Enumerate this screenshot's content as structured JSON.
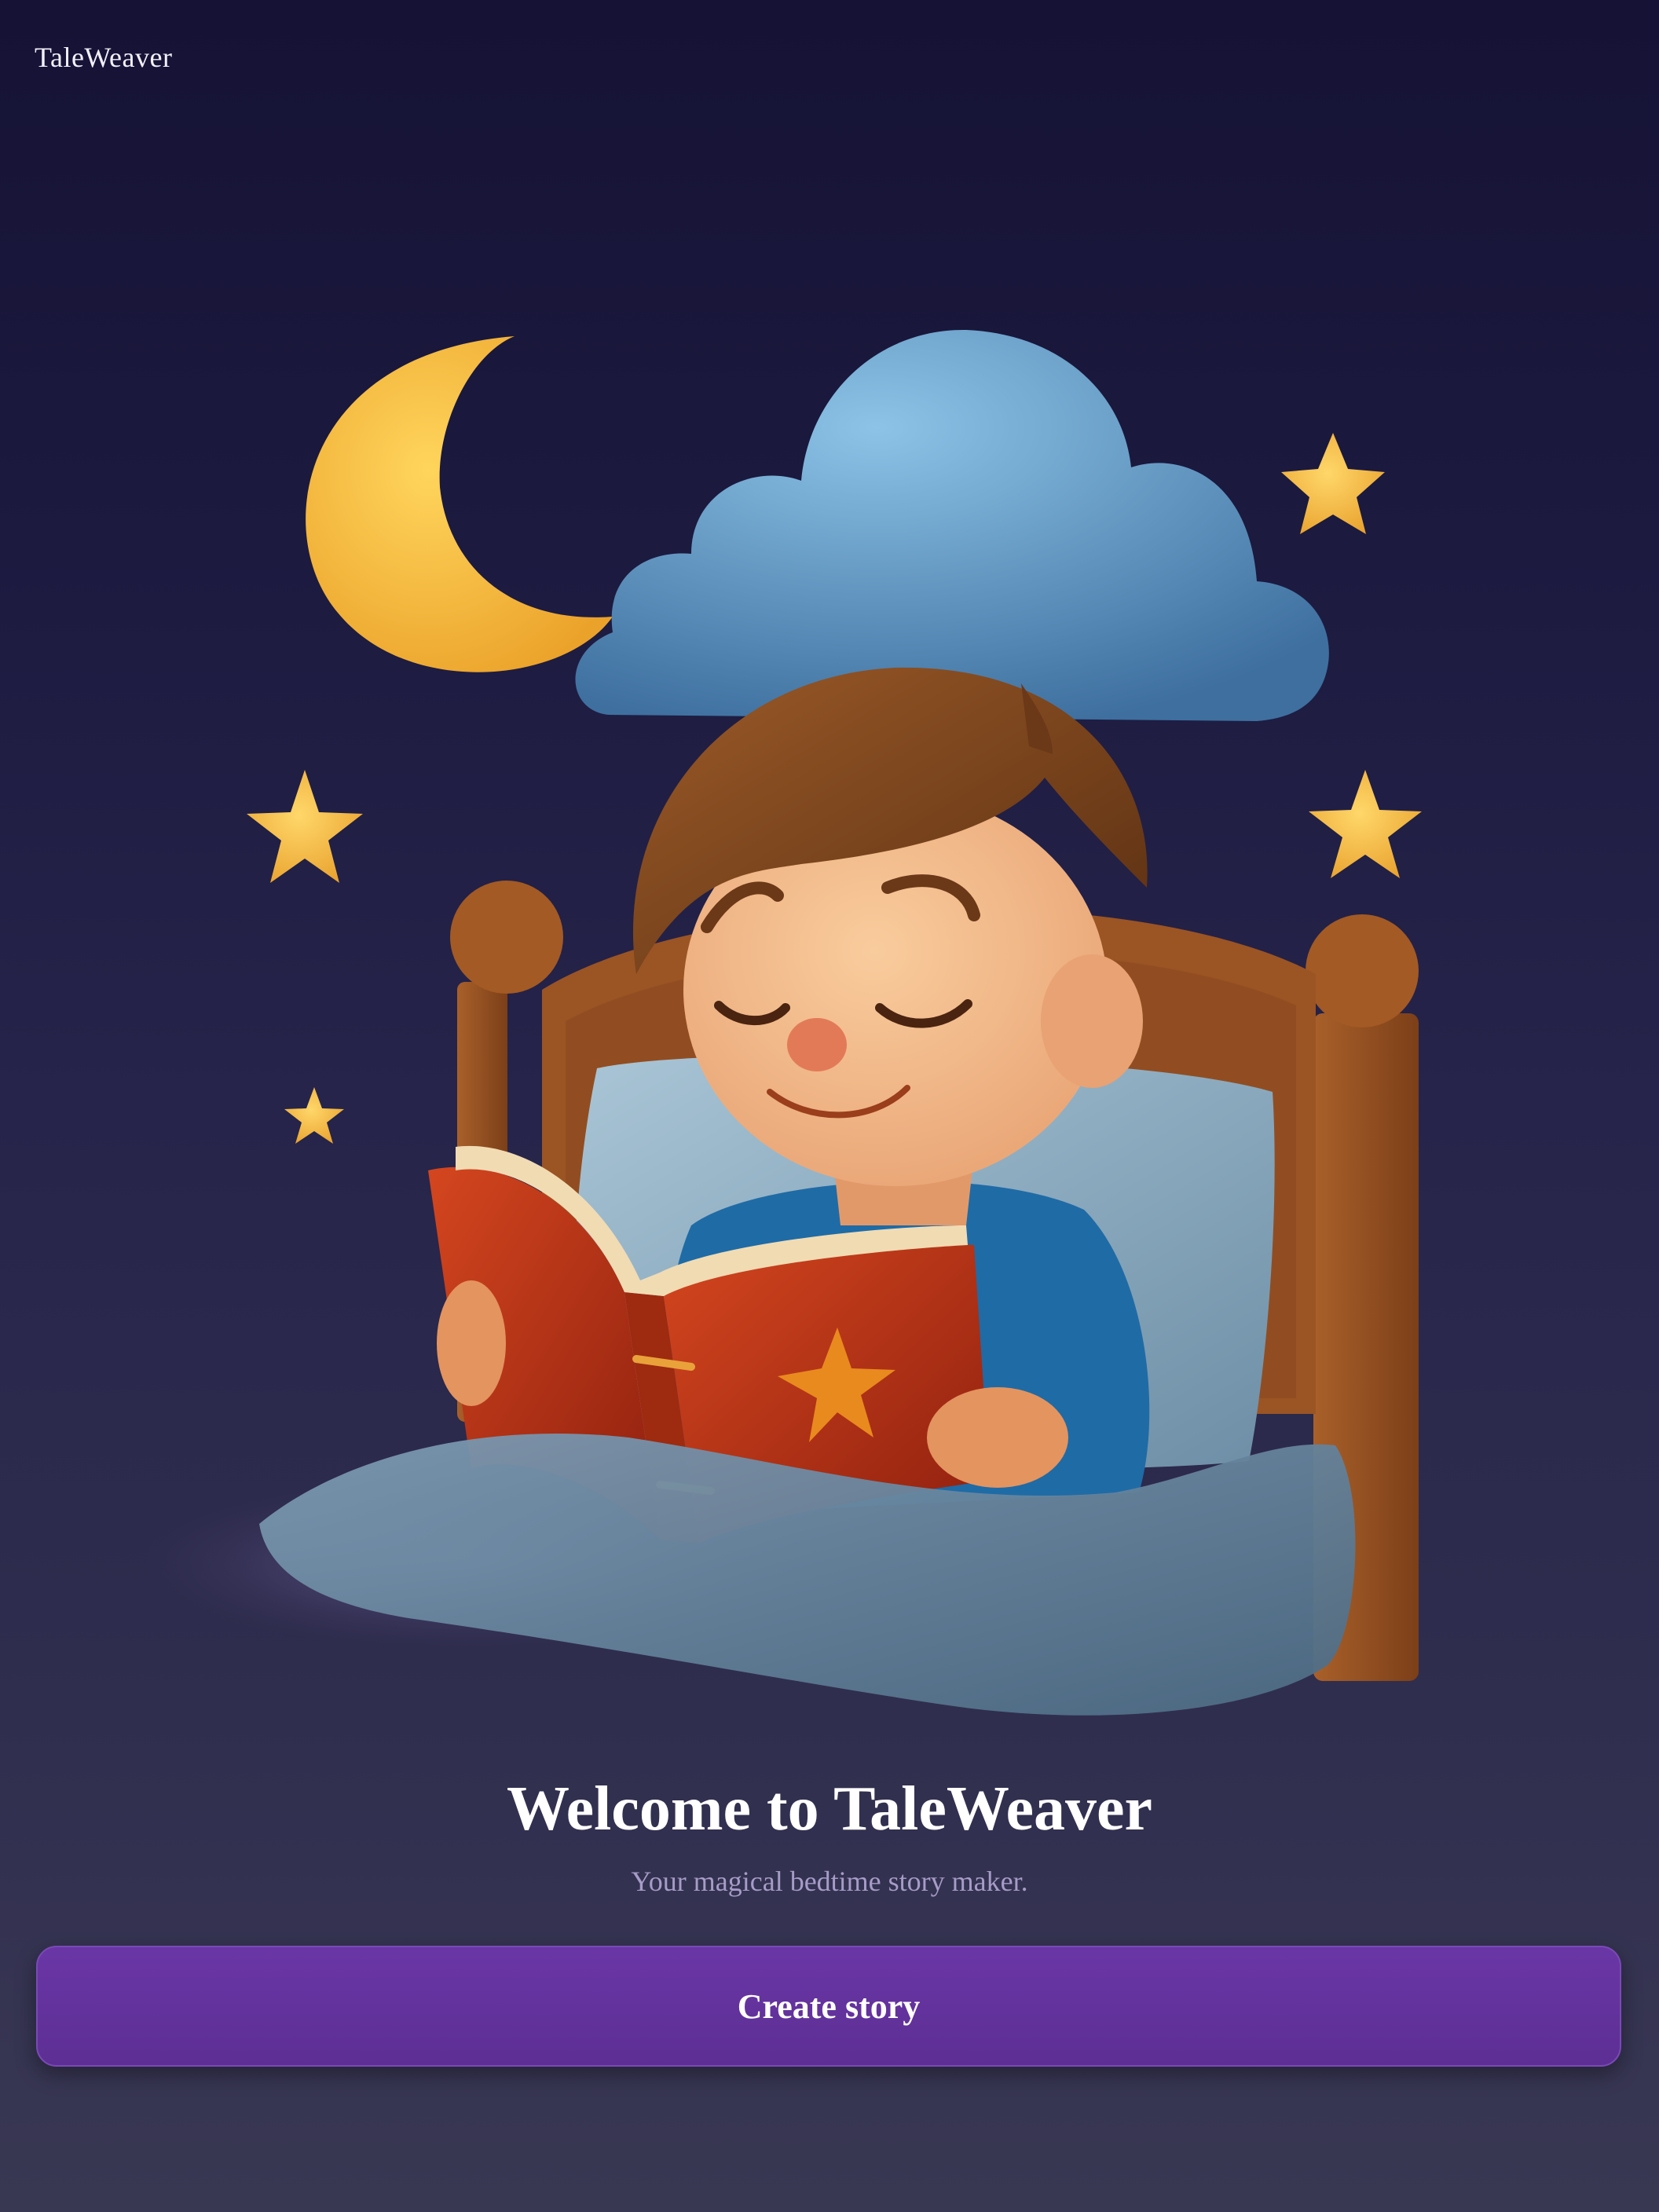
{
  "app": {
    "name": "TaleWeaver"
  },
  "hero": {
    "title": "Welcome to TaleWeaver",
    "subtitle": "Your magical bedtime story maker."
  },
  "actions": {
    "create_label": "Create story"
  },
  "colors": {
    "background_top": "#151235",
    "background_bottom": "#393853",
    "button": "#6233a0",
    "subtitle": "#a69cc7"
  },
  "icons": [
    "moon-icon",
    "cloud-icon",
    "star-icon",
    "book-icon"
  ]
}
